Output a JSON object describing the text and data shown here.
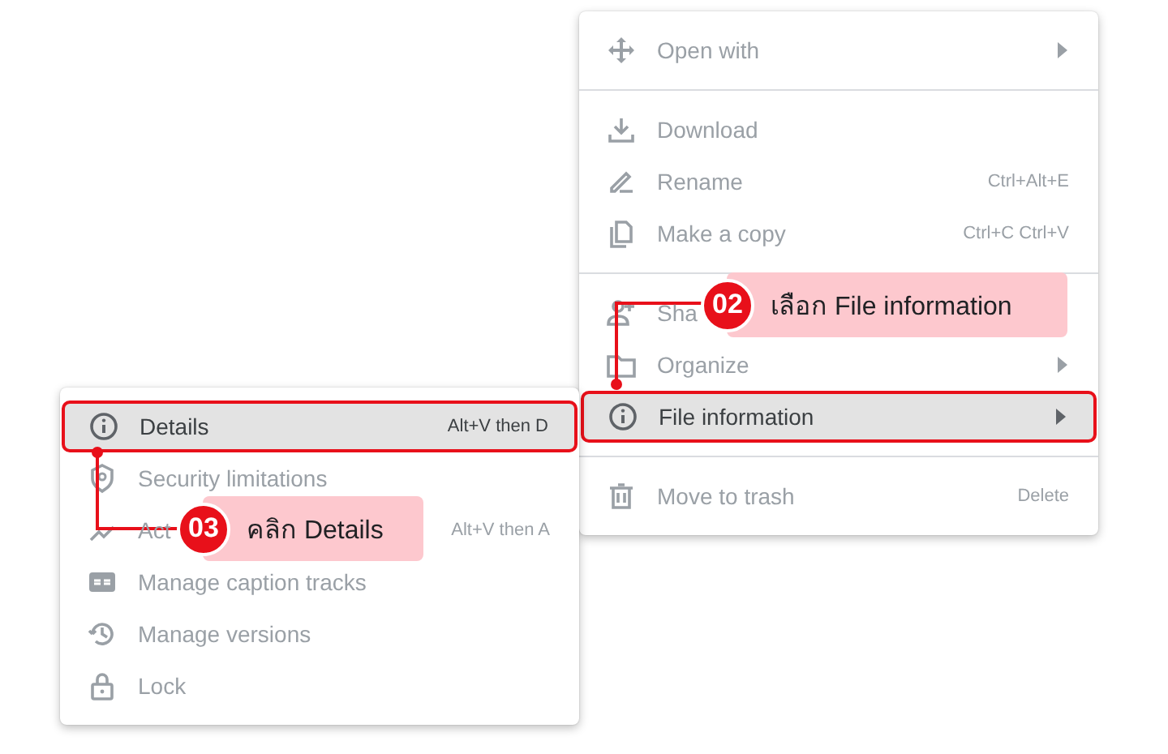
{
  "menus": [
    {
      "items": [
        {
          "kind": "item",
          "label": "Open with",
          "submenu": true,
          "disabled": true,
          "selected": false
        },
        {
          "kind": "divider"
        },
        {
          "kind": "item",
          "label": "Download",
          "disabled": true,
          "selected": false
        },
        {
          "kind": "item",
          "label": "Rename",
          "shortcut": "Ctrl+Alt+E",
          "disabled": true,
          "selected": false
        },
        {
          "kind": "item",
          "label": "Make a copy",
          "shortcut": "Ctrl+C Ctrl+V",
          "disabled": true,
          "selected": false
        },
        {
          "kind": "divider"
        },
        {
          "kind": "item",
          "label": "Sha",
          "disabled": true,
          "selected": false
        },
        {
          "kind": "item",
          "label": "Organize",
          "submenu": true,
          "disabled": true,
          "selected": false
        },
        {
          "kind": "item",
          "label": "File information",
          "submenu": true,
          "disabled": false,
          "selected": true
        },
        {
          "kind": "divider"
        },
        {
          "kind": "item",
          "label": "Move to trash",
          "shortcut": "Delete",
          "disabled": true,
          "selected": false
        }
      ]
    },
    {
      "items": [
        {
          "kind": "item",
          "label": "Details",
          "shortcut": "Alt+V then D",
          "disabled": false,
          "selected": true
        },
        {
          "kind": "item",
          "label": "Security limitations",
          "disabled": true,
          "selected": false
        },
        {
          "kind": "item",
          "label": "Act",
          "shortcut": "Alt+V then A",
          "disabled": true,
          "selected": false
        },
        {
          "kind": "item",
          "label": "Manage caption tracks",
          "disabled": true,
          "selected": false
        },
        {
          "kind": "item",
          "label": "Manage versions",
          "disabled": true,
          "selected": false
        },
        {
          "kind": "item",
          "label": "Lock",
          "disabled": true,
          "selected": false
        }
      ]
    }
  ],
  "callouts": [
    {
      "number": "02",
      "text": "เลือก File information"
    },
    {
      "number": "03",
      "text": "คลิก Details"
    }
  ]
}
